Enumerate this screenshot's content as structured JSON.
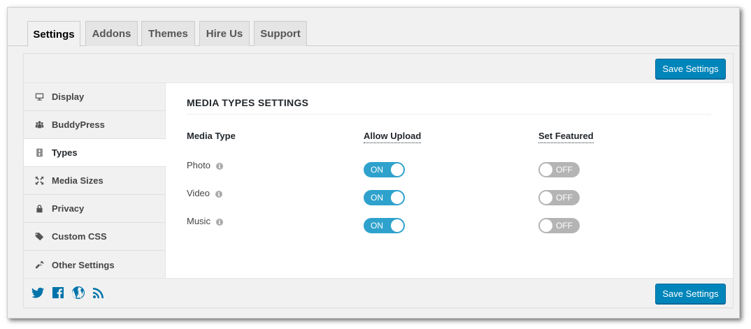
{
  "tabs": [
    {
      "label": "Settings",
      "active": true
    },
    {
      "label": "Addons",
      "active": false
    },
    {
      "label": "Themes",
      "active": false
    },
    {
      "label": "Hire Us",
      "active": false
    },
    {
      "label": "Support",
      "active": false
    }
  ],
  "toolbar": {
    "save_label": "Save Settings"
  },
  "sidebar": {
    "items": [
      {
        "label": "Display",
        "icon": "monitor-icon"
      },
      {
        "label": "BuddyPress",
        "icon": "group-icon"
      },
      {
        "label": "Types",
        "icon": "film-icon",
        "active": true
      },
      {
        "label": "Media Sizes",
        "icon": "resize-icon"
      },
      {
        "label": "Privacy",
        "icon": "lock-icon"
      },
      {
        "label": "Custom CSS",
        "icon": "tag-icon"
      },
      {
        "label": "Other Settings",
        "icon": "wrench-icon"
      }
    ]
  },
  "content": {
    "title": "MEDIA TYPES SETTINGS",
    "columns": {
      "media_type": "Media Type",
      "allow_upload": "Allow Upload",
      "set_featured": "Set Featured"
    },
    "rows": [
      {
        "label": "Photo",
        "allow_upload": "ON",
        "set_featured": "OFF"
      },
      {
        "label": "Video",
        "allow_upload": "ON",
        "set_featured": "OFF"
      },
      {
        "label": "Music",
        "allow_upload": "ON",
        "set_featured": "OFF"
      }
    ],
    "info_glyph": "i"
  },
  "social": [
    "twitter-icon",
    "facebook-icon",
    "wordpress-icon",
    "rss-icon"
  ],
  "colors": {
    "accent": "#0085ba",
    "toggle_on": "#2ea2cc",
    "toggle_off": "#b4b4b4"
  }
}
